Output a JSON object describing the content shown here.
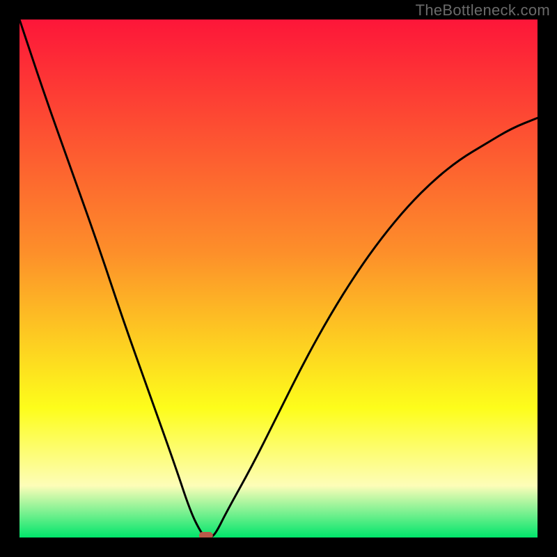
{
  "watermark": "TheBottleneck.com",
  "chart_data": {
    "type": "line",
    "title": "",
    "xlabel": "",
    "ylabel": "",
    "xlim": [
      0,
      100
    ],
    "ylim": [
      0,
      100
    ],
    "x": [
      0,
      5,
      10,
      15,
      20,
      25,
      30,
      33,
      35,
      36,
      37,
      38,
      40,
      45,
      50,
      55,
      60,
      65,
      70,
      75,
      80,
      85,
      90,
      95,
      100
    ],
    "values": [
      100,
      85,
      71,
      57,
      42,
      28,
      14,
      5,
      1,
      0,
      0,
      1,
      5,
      14,
      24,
      34,
      43,
      51,
      58,
      64,
      69,
      73,
      76,
      79,
      81
    ],
    "min_at_x": 36,
    "marker": {
      "x": 36,
      "y": 0
    },
    "gradient": {
      "top": "#fd1639",
      "mid_upper": "#fd8f2a",
      "mid": "#fdfd1b",
      "mid_lower": "#fdfdb8",
      "bottom": "#00e56b"
    },
    "curve_color": "#000000",
    "marker_color": "#b85a4a"
  }
}
